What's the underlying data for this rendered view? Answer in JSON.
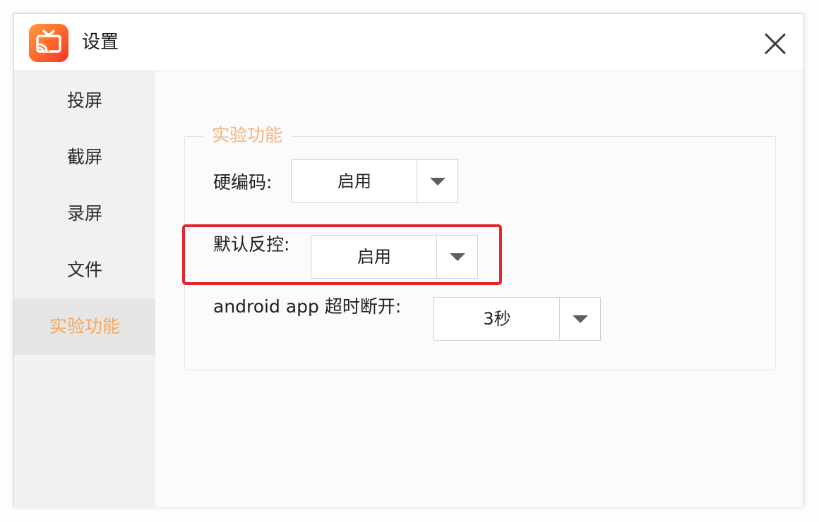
{
  "window": {
    "title": "设置",
    "app_icon": "cast-screen-icon",
    "close_icon": "close-icon"
  },
  "sidebar": {
    "items": [
      {
        "label": "投屏",
        "active": false
      },
      {
        "label": "截屏",
        "active": false
      },
      {
        "label": "录屏",
        "active": false
      },
      {
        "label": "文件",
        "active": false
      },
      {
        "label": "实验功能",
        "active": true
      }
    ]
  },
  "main": {
    "group_title": "实验功能",
    "settings": [
      {
        "label": "硬编码:",
        "value": "启用"
      },
      {
        "label": "默认反控:",
        "value": "启用",
        "highlighted": true
      },
      {
        "label": "android app 超时断开:",
        "value": "3秒"
      }
    ]
  },
  "colors": {
    "accent": "#f7a760",
    "highlight_border": "#e3262b",
    "logo_gradient_start": "#ff9b3d",
    "logo_gradient_end": "#f0372a"
  }
}
